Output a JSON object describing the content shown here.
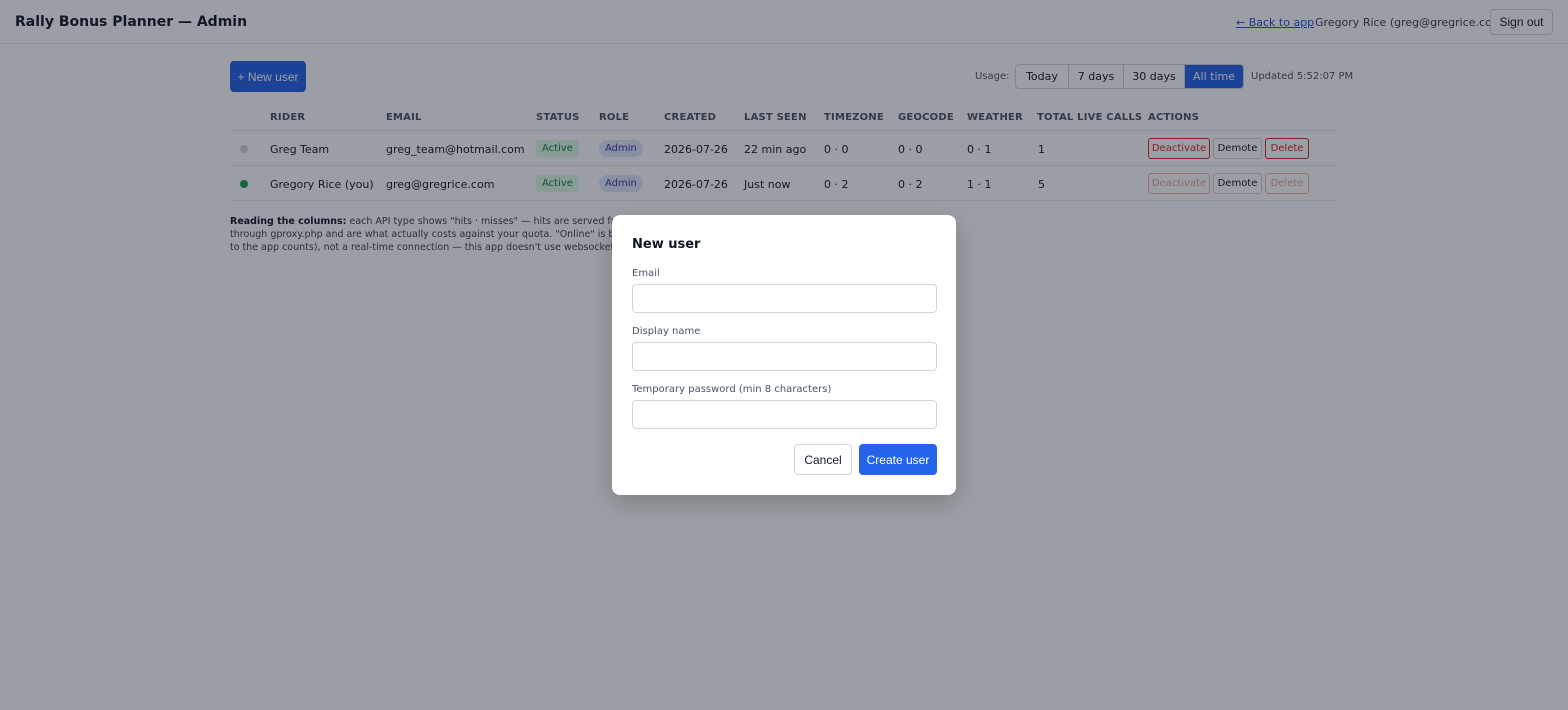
{
  "header": {
    "title": "Rally Bonus Planner — Admin",
    "back_link": "← Back to app",
    "user": "Gregory Rice (greg@gregrice.com)",
    "sign_out": "Sign out"
  },
  "toolbar": {
    "new_user": "+ New user",
    "usage_label": "Usage:",
    "ranges": [
      "Today",
      "7 days",
      "30 days",
      "All time"
    ],
    "selected_range": "All time",
    "updated": "Updated 5:52:07 PM"
  },
  "table": {
    "columns": [
      "RIDER",
      "EMAIL",
      "STATUS",
      "ROLE",
      "CREATED",
      "LAST SEEN",
      "TIMEZONE",
      "GEOCODE",
      "WEATHER",
      "TOTAL LIVE CALLS",
      "ACTIONS"
    ],
    "rows": [
      {
        "online": false,
        "rider": "Greg Team",
        "email": "greg_team@hotmail.com",
        "status": "Active",
        "role": "Admin",
        "created": "2026-07-26",
        "last_seen": "22 min ago",
        "timezone": "0 · 0",
        "geocode": "0 · 0",
        "weather": "0 · 1",
        "total_live_calls": "1",
        "actions": [
          "Deactivate",
          "Demote",
          "Delete"
        ]
      },
      {
        "online": true,
        "rider": "Gregory Rice (you)",
        "email": "greg@gregrice.com",
        "status": "Active",
        "role": "Admin",
        "created": "2026-07-26",
        "last_seen": "Just now",
        "timezone": "0 · 2",
        "geocode": "0 · 2",
        "weather": "1 · 1",
        "total_live_calls": "5",
        "actions": [
          "Deactivate",
          "Demote",
          "Delete"
        ]
      }
    ]
  },
  "note": {
    "bold": "Reading the columns:",
    "line1": " each API type shows \"hits · misses\" — hits are served free from th",
    "line2": "through gproxy.php and are what actually costs against your quota. \"Online\" is based on",
    "line3": "to the app counts), not a real-time connection — this app doesn't use websockets, so it'"
  },
  "modal": {
    "title": "New user",
    "email_label": "Email",
    "email_value": "",
    "display_name_label": "Display name",
    "display_name_value": "",
    "password_label": "Temporary password (min 8 characters)",
    "password_value": "",
    "cancel": "Cancel",
    "create": "Create user"
  },
  "colors": {
    "primary": "#2563eb",
    "danger": "#dc2626",
    "online": "#16a34a",
    "offline": "#d1d5db",
    "active_bg": "#dcfce7",
    "admin_bg": "#e0e7ff"
  }
}
